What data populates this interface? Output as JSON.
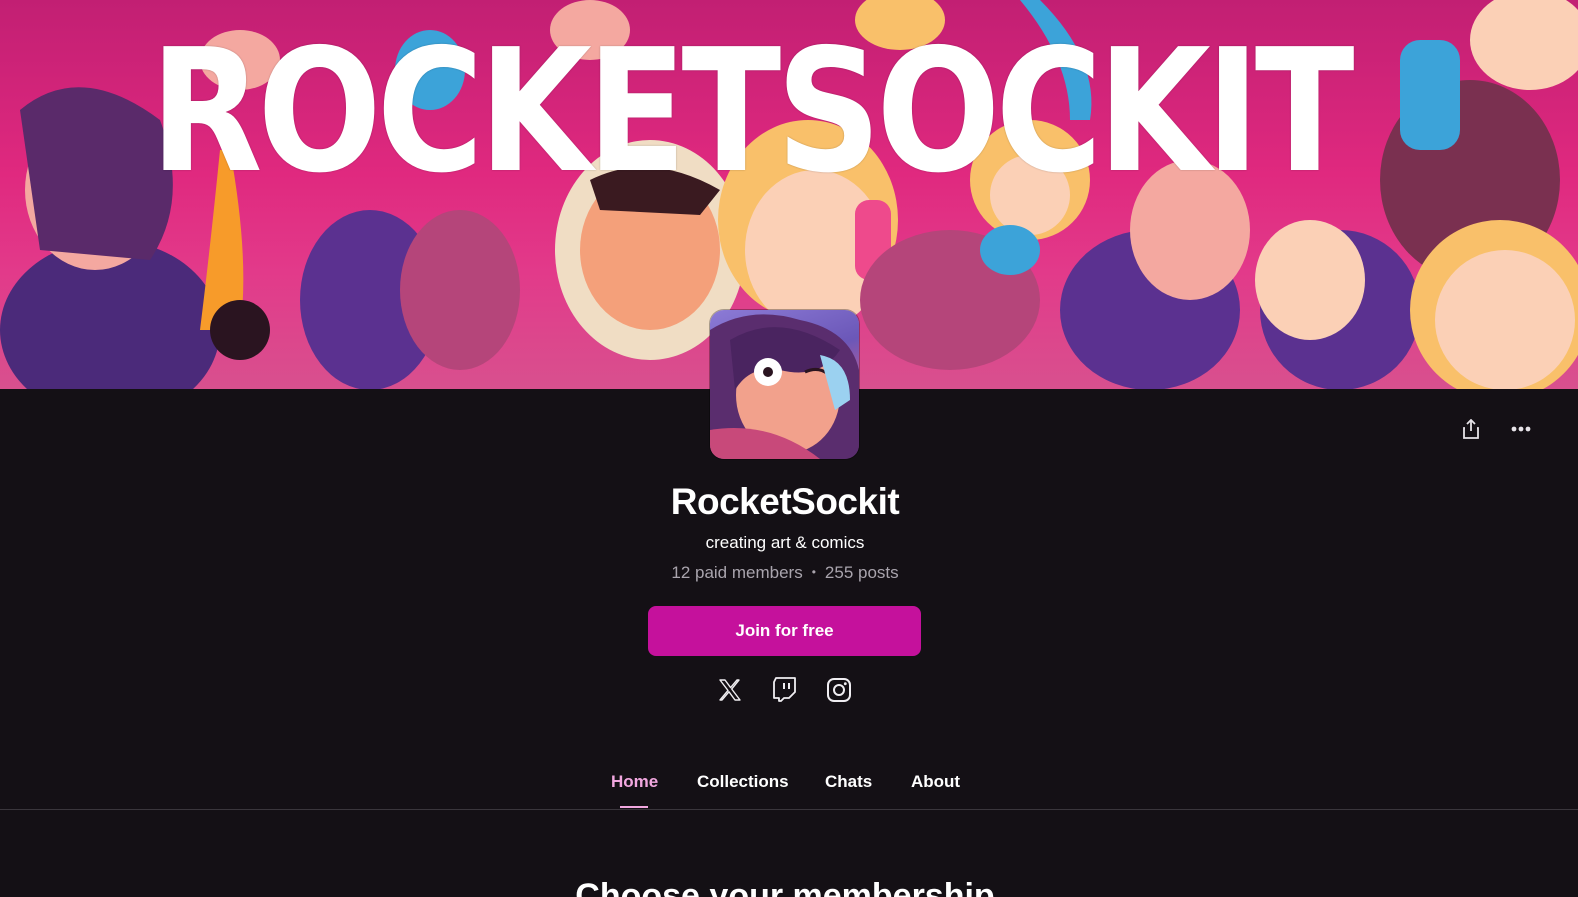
{
  "banner": {
    "title": "ROCKETSOCKIT"
  },
  "profile": {
    "name": "RocketSockit",
    "tagline": "creating art & comics",
    "paid_members": "12 paid members",
    "separator": "•",
    "posts": "255 posts"
  },
  "actions": {
    "share_icon": "share-icon",
    "more_icon": "more-options-icon"
  },
  "join_button": {
    "label": "Join for free"
  },
  "social": [
    {
      "icon": "x-icon"
    },
    {
      "icon": "twitch-icon"
    },
    {
      "icon": "instagram-icon"
    }
  ],
  "tabs": [
    {
      "label": "Home",
      "active": true
    },
    {
      "label": "Collections",
      "active": false
    },
    {
      "label": "Chats",
      "active": false
    },
    {
      "label": "About",
      "active": false
    }
  ],
  "colors": {
    "background": "#141015",
    "accent": "#c5119c",
    "active_tab": "#f1a7df",
    "muted_text": "#a9a4ad",
    "banner_pink": "#e0297f"
  },
  "section": {
    "heading": "Choose your membership"
  }
}
